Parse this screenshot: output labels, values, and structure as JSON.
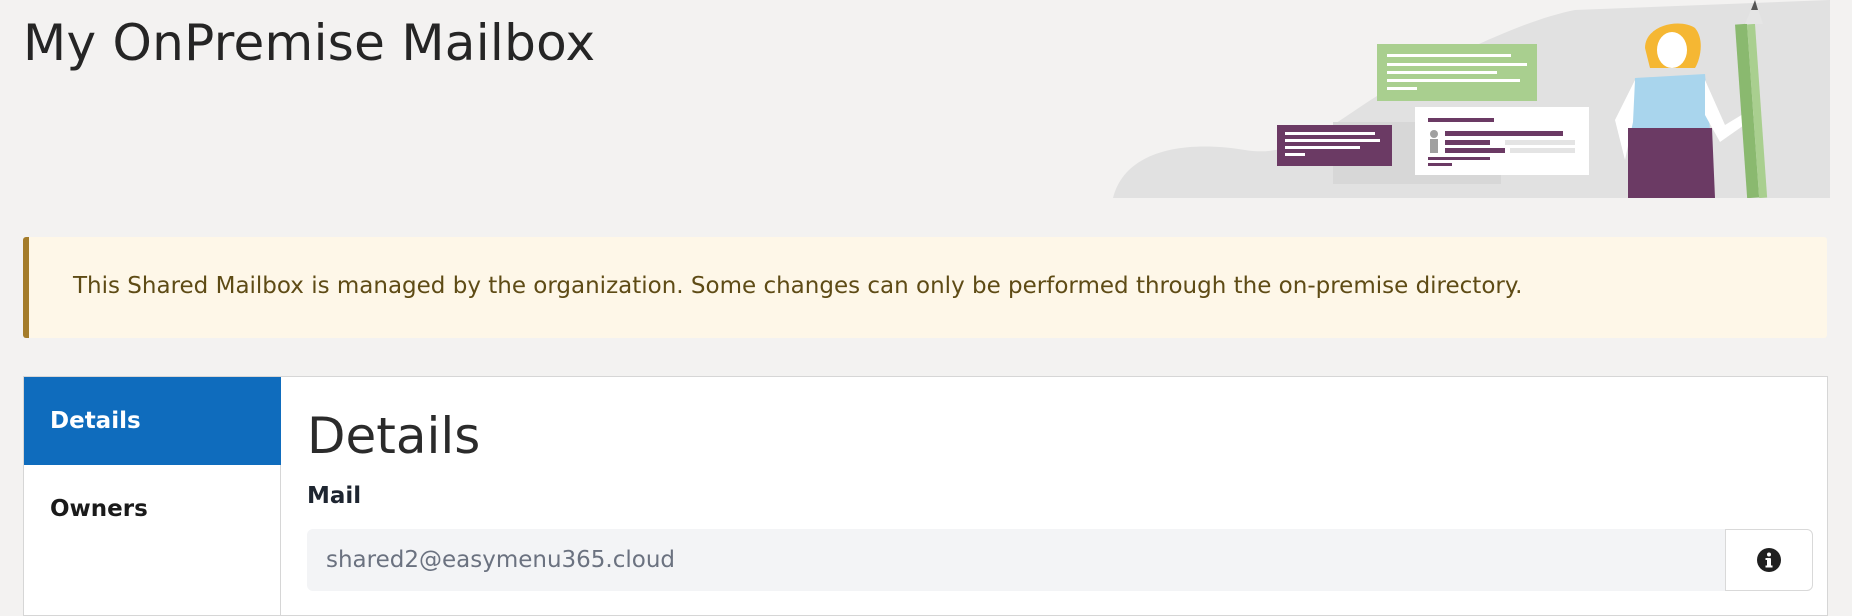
{
  "header": {
    "title": "My OnPremise Mailbox"
  },
  "notice": {
    "text": "This Shared Mailbox is managed by the organization. Some changes can only be performed through the on-premise directory."
  },
  "side_nav": {
    "items": [
      {
        "label": "Details",
        "active": true
      },
      {
        "label": "Owners",
        "active": false
      }
    ]
  },
  "details": {
    "title": "Details",
    "mail_label": "Mail",
    "mail_value": "shared2@easymenu365.cloud",
    "info_icon": "info-circle-icon"
  },
  "colors": {
    "accent": "#0f6cbd",
    "notice_bg": "#fef7e8",
    "notice_border": "#a47c2a",
    "page_bg": "#f3f2f1"
  }
}
